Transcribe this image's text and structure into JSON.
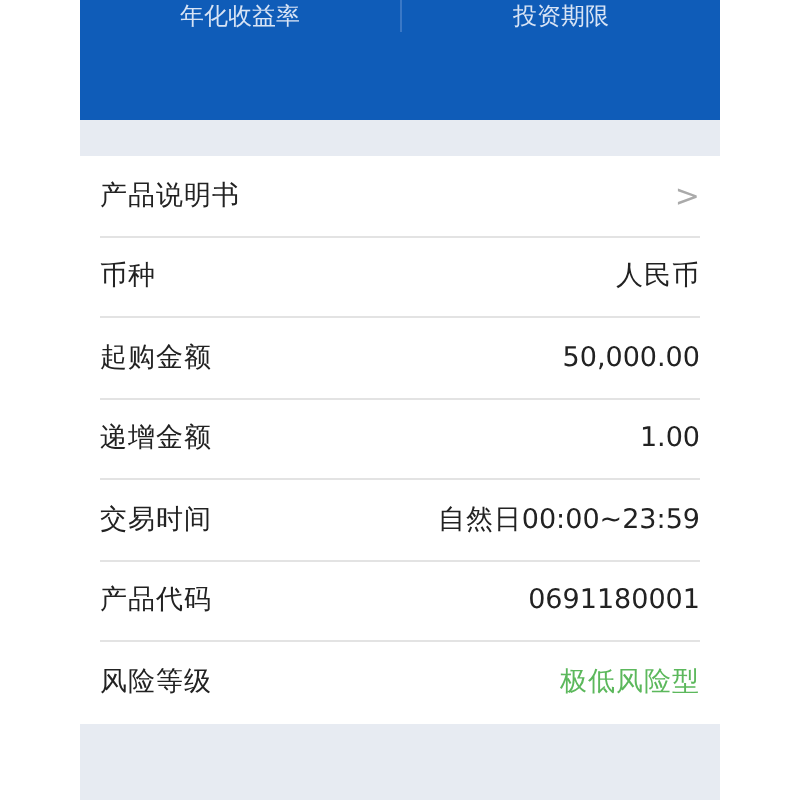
{
  "header": {
    "labels": [
      "年化收益率",
      "投资期限"
    ]
  },
  "rows": [
    {
      "kind": "link",
      "label": "产品说明书",
      "value": ">"
    },
    {
      "kind": "plain",
      "label": "币种",
      "value": "人民币"
    },
    {
      "kind": "plain",
      "label": "起购金额",
      "value": "50,000.00"
    },
    {
      "kind": "plain",
      "label": "递增金额",
      "value": "1.00"
    },
    {
      "kind": "plain",
      "label": "交易时间",
      "value": "自然日00:00~23:59"
    },
    {
      "kind": "plain",
      "label": "产品代码",
      "value": "0691180001"
    },
    {
      "kind": "risk",
      "label": "风险等级",
      "value": "极低风险型"
    }
  ]
}
